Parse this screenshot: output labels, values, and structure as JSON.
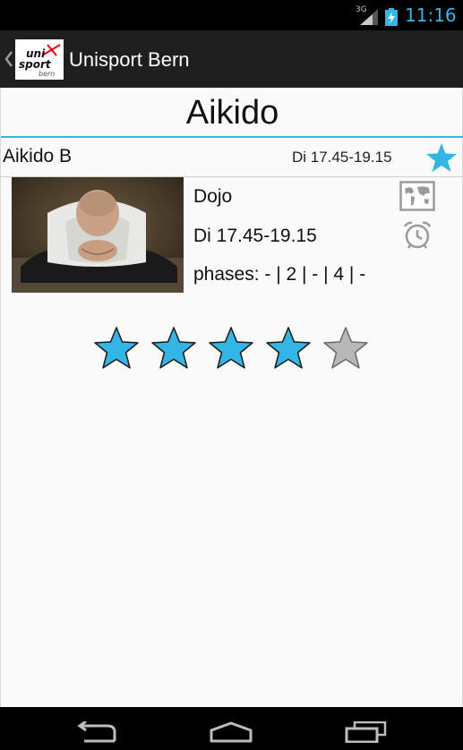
{
  "status_bar": {
    "network": "3G",
    "time": "11:16",
    "accent": "#33b5e5"
  },
  "action_bar": {
    "title": "Unisport Bern",
    "logo_text": "unisport bern",
    "icons": [
      "back-chevron-icon",
      "unisport-logo"
    ]
  },
  "page": {
    "title": "Aikido"
  },
  "course": {
    "name": "Aikido B",
    "time": "Di 17.45-19.15",
    "is_favorite": true,
    "location": "Dojo",
    "detail_time": "Di 17.45-19.15",
    "phases": "phases: - | 2 | - | 4 | -",
    "photo_alt": "aikido stretching photo"
  },
  "rating": {
    "value": 4,
    "max": 5,
    "filled_color": "#33b5e5",
    "empty_color": "#b8b8b8"
  },
  "nav_bar": {
    "icons": [
      "back-icon",
      "home-icon",
      "recent-apps-icon"
    ]
  }
}
